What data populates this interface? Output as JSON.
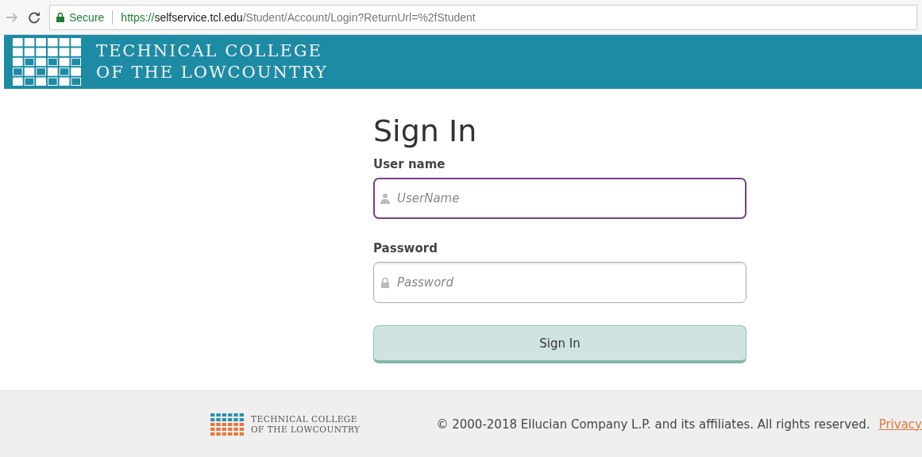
{
  "browser": {
    "secure_label": "Secure",
    "url_scheme": "https://",
    "url_host": "selfservice.tcl.edu",
    "url_path": "/Student/Account/Login?ReturnUrl=%2fStudent"
  },
  "header": {
    "title_line1": "TECHNICAL COLLEGE",
    "title_line2": "OF THE LOWCOUNTRY"
  },
  "form": {
    "title": "Sign In",
    "fields": [
      {
        "label": "User name",
        "placeholder": "UserName",
        "kind": "user",
        "focused": true
      },
      {
        "label": "Password",
        "placeholder": "Password",
        "kind": "password",
        "focused": false
      }
    ],
    "button": "Sign In"
  },
  "footer": {
    "logo_line1": "TECHNICAL COLLEGE",
    "logo_line2": "OF THE LOWCOUNTRY",
    "copyright": "© 2000-2018 Ellucian Company L.P. and its affiliates. All rights reserved.",
    "link": "Privacy"
  }
}
